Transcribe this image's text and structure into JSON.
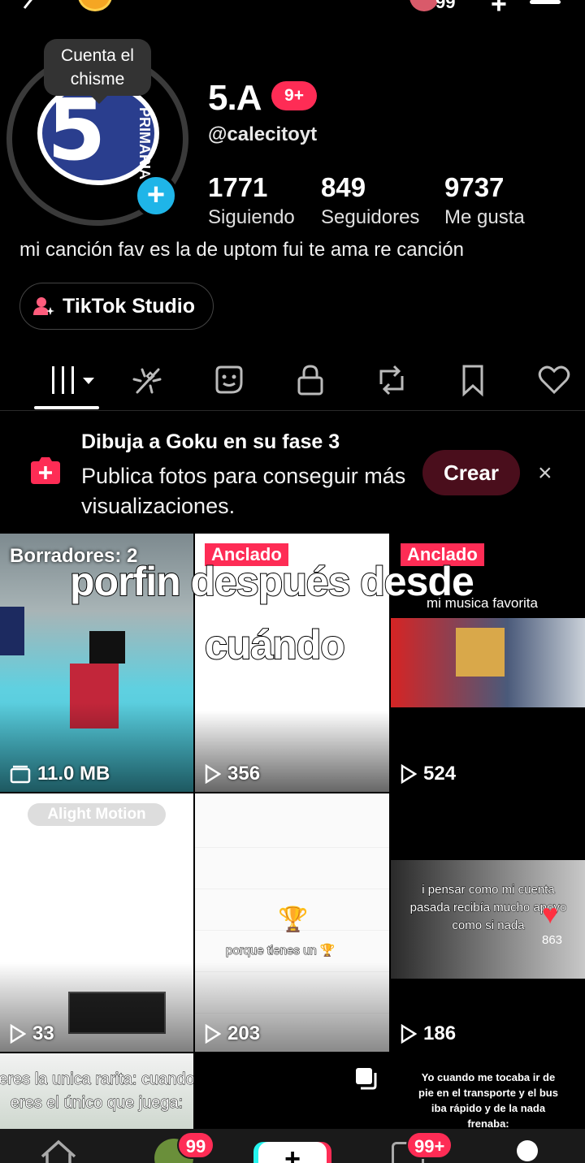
{
  "top": {
    "notifications_count": "99",
    "plus_glyph": "+"
  },
  "profile": {
    "tooltip": "Cuenta el chisme",
    "avatar_word": "PRIMARIA",
    "avatar_digit": "5",
    "name": "5.A",
    "name_badge": "9+",
    "handle": "@calecitoyt",
    "stats": [
      {
        "value": "1771",
        "label": "Siguiendo"
      },
      {
        "value": "849",
        "label": "Seguidores"
      },
      {
        "value": "9737",
        "label": "Me gusta"
      }
    ],
    "bio": "mi canción fav es la de uptom fui te ama re canción",
    "studio_button": "TikTok Studio"
  },
  "tabs": [
    {
      "icon": "grid-icon",
      "active": true
    },
    {
      "icon": "sparkle-icon"
    },
    {
      "icon": "sticker-icon"
    },
    {
      "icon": "lock-icon"
    },
    {
      "icon": "repost-icon"
    },
    {
      "icon": "bookmark-icon"
    },
    {
      "icon": "heart-icon"
    }
  ],
  "promo": {
    "title": "Dibuja a Goku en su fase 3",
    "text": "Publica fotos para conseguir más visualizaciones.",
    "create_label": "Crear",
    "close_glyph": "×"
  },
  "grid": {
    "overlay_caption_1": "porfin después desde",
    "overlay_caption_2": "cuándo",
    "cells": [
      {
        "label": "Borradores: 2",
        "meta": "11.0 MB"
      },
      {
        "pinned": "Anclado",
        "views": "356"
      },
      {
        "pinned": "Anclado",
        "views": "524",
        "caption": "mi musica favorita"
      },
      {
        "views": "33",
        "caption": "Alight Motion"
      },
      {
        "views": "203",
        "caption": "porque tienes un 🏆"
      },
      {
        "views": "186",
        "caption": "i pensar como mi cuenta pasada recibía mucho apoyo como si nada",
        "count": "863"
      },
      {
        "caption": "eres la unica rarita: cuando eres el único que juega:"
      },
      {},
      {
        "caption": "Yo cuando me tocaba ir de pie en el transporte y el bus iba rápido y de la nada frenaba:"
      }
    ]
  },
  "bottom_nav": {
    "friends_badge": "99",
    "inbox_badge": "99+",
    "create_glyph": "+"
  },
  "colors": {
    "accent": "#fe2c55",
    "background": "#000000",
    "add_button": "#1fb5e8"
  }
}
